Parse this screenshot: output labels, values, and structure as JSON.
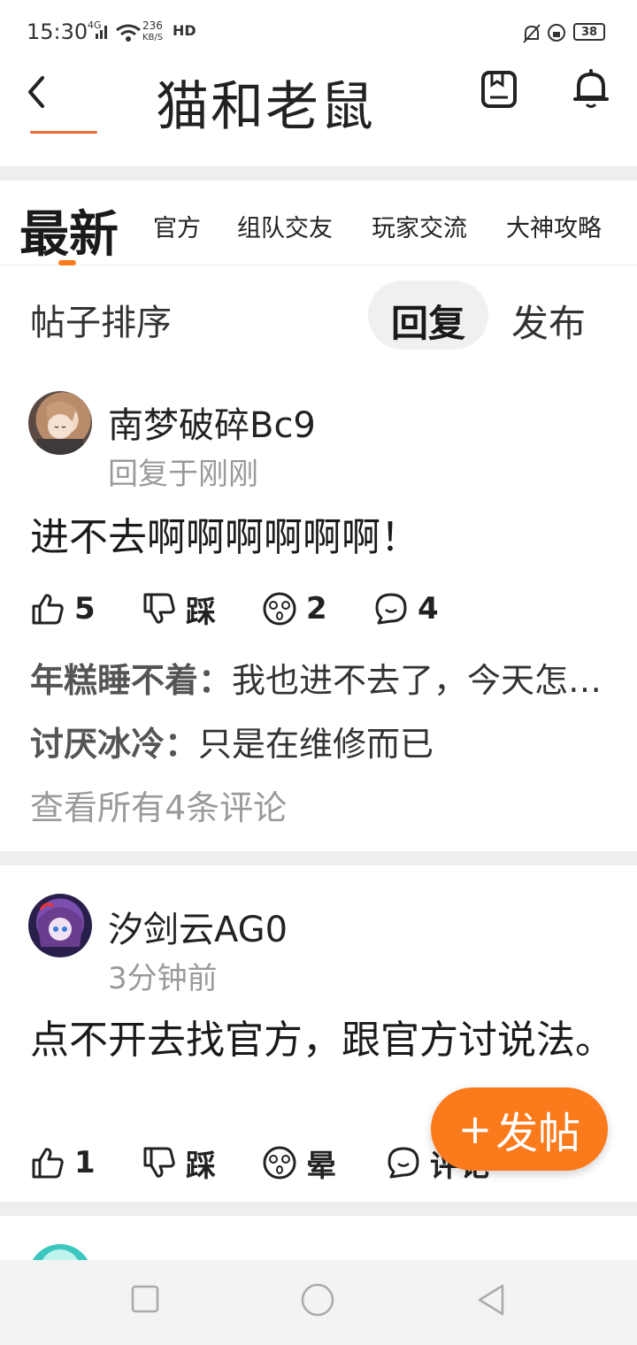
{
  "theme": {
    "accent": "#fa7a1c",
    "divider": "#eeeeee"
  },
  "status_bar": {
    "time": "15:30",
    "net_type": "4G",
    "speed_value": "236",
    "speed_unit": "KB/S",
    "hd": "HD",
    "battery": "38"
  },
  "header": {
    "title": "猫和老鼠",
    "icons": [
      "back-arrow-icon",
      "document-icon",
      "bell-icon"
    ]
  },
  "tabs": {
    "items": [
      "最新",
      "官方",
      "组队交友",
      "玩家交流",
      "大神攻略"
    ],
    "active_index": 0
  },
  "sort": {
    "label": "帖子排序",
    "options": [
      "回复",
      "发布"
    ],
    "selected": "回复"
  },
  "posts": [
    {
      "author": "南梦破碎Bc9",
      "time": "回复于刚刚",
      "content": "进不去啊啊啊啊啊啊！",
      "likes": "5",
      "dislike_label": "踩",
      "dizzy": "2",
      "comments": "4",
      "comment_previews": [
        {
          "user": "年糕睡不着：",
          "text": "我也进不去了，今天怎么了"
        },
        {
          "user": "讨厌冰冷：",
          "text": "只是在维修而已"
        }
      ],
      "see_all": "查看所有4条评论"
    },
    {
      "author": "汐剑云AG0",
      "time": "3分钟前",
      "content": "点不开去找官方，跟官方讨说法。",
      "likes": "1",
      "dislike_label": "踩",
      "dizzy": "晕",
      "comments": "评论"
    }
  ],
  "fab": {
    "plus": "+",
    "label": "发帖"
  },
  "navbar": {
    "icons": [
      "recent-apps-icon",
      "home-icon",
      "back-icon"
    ]
  }
}
